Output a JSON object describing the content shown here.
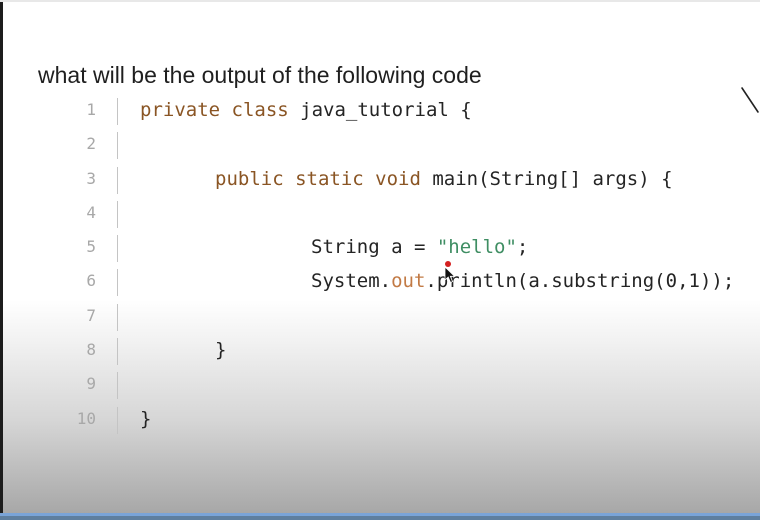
{
  "heading": "what will be the output of the following code",
  "code": {
    "lines": [
      {
        "num": "1",
        "indent": 0,
        "tokens": [
          {
            "text": "private class ",
            "type": "kw"
          },
          {
            "text": "java_tutorial {",
            "type": "plain"
          }
        ]
      },
      {
        "num": "2",
        "indent": 0,
        "tokens": []
      },
      {
        "num": "3",
        "indent": 1,
        "tokens": [
          {
            "text": "public static void ",
            "type": "kw"
          },
          {
            "text": "main(String[] args) {",
            "type": "plain"
          }
        ]
      },
      {
        "num": "4",
        "indent": 0,
        "tokens": []
      },
      {
        "num": "5",
        "indent": 2,
        "tokens": [
          {
            "text": "String a = ",
            "type": "plain"
          },
          {
            "text": "\"hello\"",
            "type": "str"
          },
          {
            "text": ";",
            "type": "plain"
          }
        ]
      },
      {
        "num": "6",
        "indent": 2,
        "tokens": [
          {
            "text": "System.",
            "type": "plain"
          },
          {
            "text": "out",
            "type": "fld"
          },
          {
            "text": ".println(a.substring(0,1));",
            "type": "plain"
          }
        ]
      },
      {
        "num": "7",
        "indent": 0,
        "tokens": []
      },
      {
        "num": "8",
        "indent": 1,
        "tokens": [
          {
            "text": "}",
            "type": "plain"
          }
        ]
      },
      {
        "num": "9",
        "indent": 0,
        "tokens": []
      },
      {
        "num": "10",
        "indent": 0,
        "tokens": [
          {
            "text": "}",
            "type": "plain"
          }
        ]
      }
    ]
  },
  "colors": {
    "keyword": "#8a5524",
    "string": "#3f8e63",
    "field": "#c27a45",
    "line_number": "#a8a8a8",
    "cursor_dot": "#d42020"
  },
  "icons": {
    "cursor": "mouse-pointer-icon",
    "corner_mark": "annotation-stroke-icon"
  }
}
